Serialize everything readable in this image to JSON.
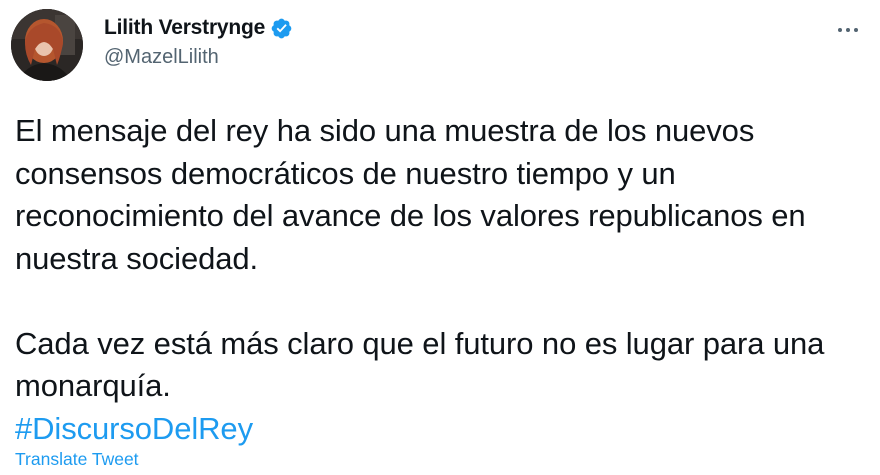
{
  "author": {
    "display_name": "Lilith Verstrynge",
    "handle": "@MazelLilith",
    "verified": true,
    "avatar_icon": "profile-photo"
  },
  "tweet": {
    "paragraphs": [
      "El mensaje del rey ha sido una muestra de los nuevos consensos democráticos de nuestro tiempo y un reconocimiento del avance de los valores republicanos en nuestra sociedad.",
      "Cada vez está más claro que el futuro no es lugar para una monarquía."
    ],
    "hashtag": "#DiscursoDelRey",
    "translate_label": "Translate Tweet"
  },
  "icons": {
    "verified": "verified-badge-icon",
    "more": "more-options-icon"
  },
  "colors": {
    "accent": "#1d9bf0",
    "text": "#0f1419",
    "secondary": "#536471"
  }
}
